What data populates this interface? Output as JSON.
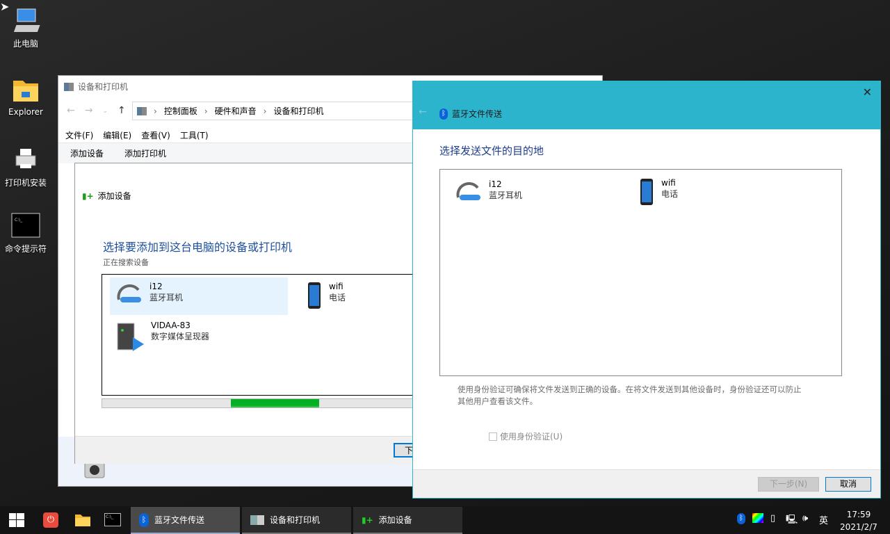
{
  "desktop": {
    "icons": [
      {
        "label": "此电脑",
        "icon": "computer-icon"
      },
      {
        "label": "Explorer",
        "icon": "folder-icon"
      },
      {
        "label": "打印机安装",
        "icon": "printer-icon"
      },
      {
        "label": "命令提示符",
        "icon": "cmd-icon"
      }
    ]
  },
  "devices_window": {
    "title": "设备和打印机",
    "breadcrumb": [
      "控制面板",
      "硬件和声音",
      "设备和打印机"
    ],
    "menu": [
      "文件(F)",
      "编辑(E)",
      "查看(V)",
      "工具(T)"
    ],
    "toolbar": [
      "添加设备",
      "添加打印机"
    ]
  },
  "add_device_dialog": {
    "title": "添加设备",
    "heading": "选择要添加到这台电脑的设备或打印机",
    "status": "正在搜索设备",
    "devices": [
      {
        "name": "i12",
        "type": "蓝牙耳机",
        "selected": true
      },
      {
        "name": "wifi",
        "type": "电话"
      },
      {
        "name": "VIDAA-83",
        "type": "数字媒体呈现器"
      }
    ],
    "progress_indeterminate": true,
    "next_button": "下"
  },
  "bt_window": {
    "title": "蓝牙文件传送",
    "heading": "选择发送文件的目的地",
    "devices": [
      {
        "name": "i12",
        "type": "蓝牙耳机"
      },
      {
        "name": "wifi",
        "type": "电话"
      }
    ],
    "description": "使用身份验证可确保将文件发送到正确的设备。在将文件发送到其他设备时，身份验证还可以防止其他用户查看该文件。",
    "auth_checkbox": {
      "label": "使用身份验证(U)",
      "checked": false,
      "enabled": false
    },
    "next_button": "下一步(N)",
    "cancel_button": "取消",
    "accent": "#2bb4cc"
  },
  "taskbar": {
    "tasks": [
      {
        "label": "蓝牙文件传送",
        "active": true
      },
      {
        "label": "设备和打印机"
      },
      {
        "label": "添加设备"
      }
    ],
    "ime": "英",
    "time": "17:59",
    "date": "2021/2/7"
  }
}
